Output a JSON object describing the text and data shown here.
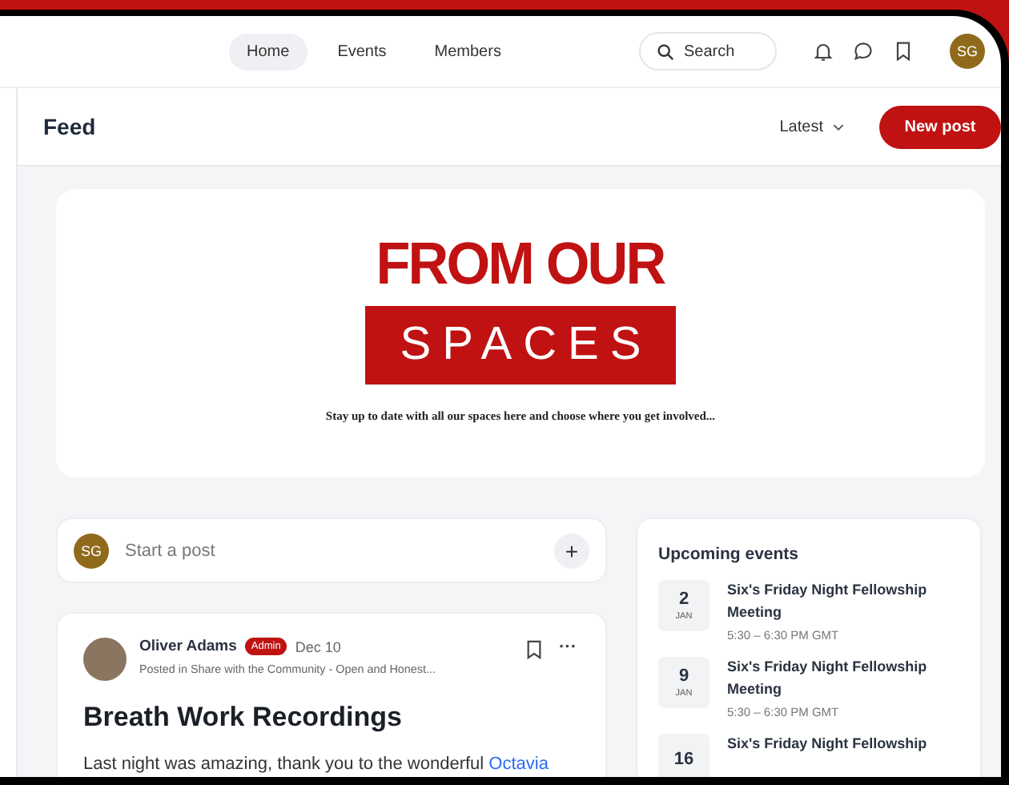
{
  "nav": {
    "tabs": [
      {
        "label": "Home",
        "selected": true
      },
      {
        "label": "Events",
        "selected": false
      },
      {
        "label": "Members",
        "selected": false
      }
    ],
    "search": {
      "placeholder": "Search"
    },
    "avatar": "SG"
  },
  "feed": {
    "title": "Feed",
    "sort": "Latest",
    "new_post": "New post"
  },
  "banner": {
    "heading": "FROM OUR",
    "highlight": "SPACES",
    "tagline": "Stay up to date with all our spaces here and choose where you get involved..."
  },
  "composer": {
    "avatar": "SG",
    "placeholder": "Start a post",
    "add": "+"
  },
  "post": {
    "author": "Oliver Adams",
    "badge": "Admin",
    "date": "Dec 10",
    "posted_in": "Posted in Share with the Community - Open and Honest...",
    "more": "···",
    "title": "Breath Work Recordings",
    "body": "Last night was amazing, thank you to the wonderful",
    "link": "Octavia"
  },
  "events": {
    "title": "Upcoming events",
    "items": [
      {
        "day": "2",
        "month": "JAN",
        "name": "Six's Friday Night Fellowship Meeting",
        "time": "5:30 – 6:30 PM GMT"
      },
      {
        "day": "9",
        "month": "JAN",
        "name": "Six's Friday Night Fellowship Meeting",
        "time": "5:30 – 6:30 PM GMT"
      },
      {
        "day": "16",
        "name": "Six's Friday Night Fellowship"
      }
    ]
  }
}
